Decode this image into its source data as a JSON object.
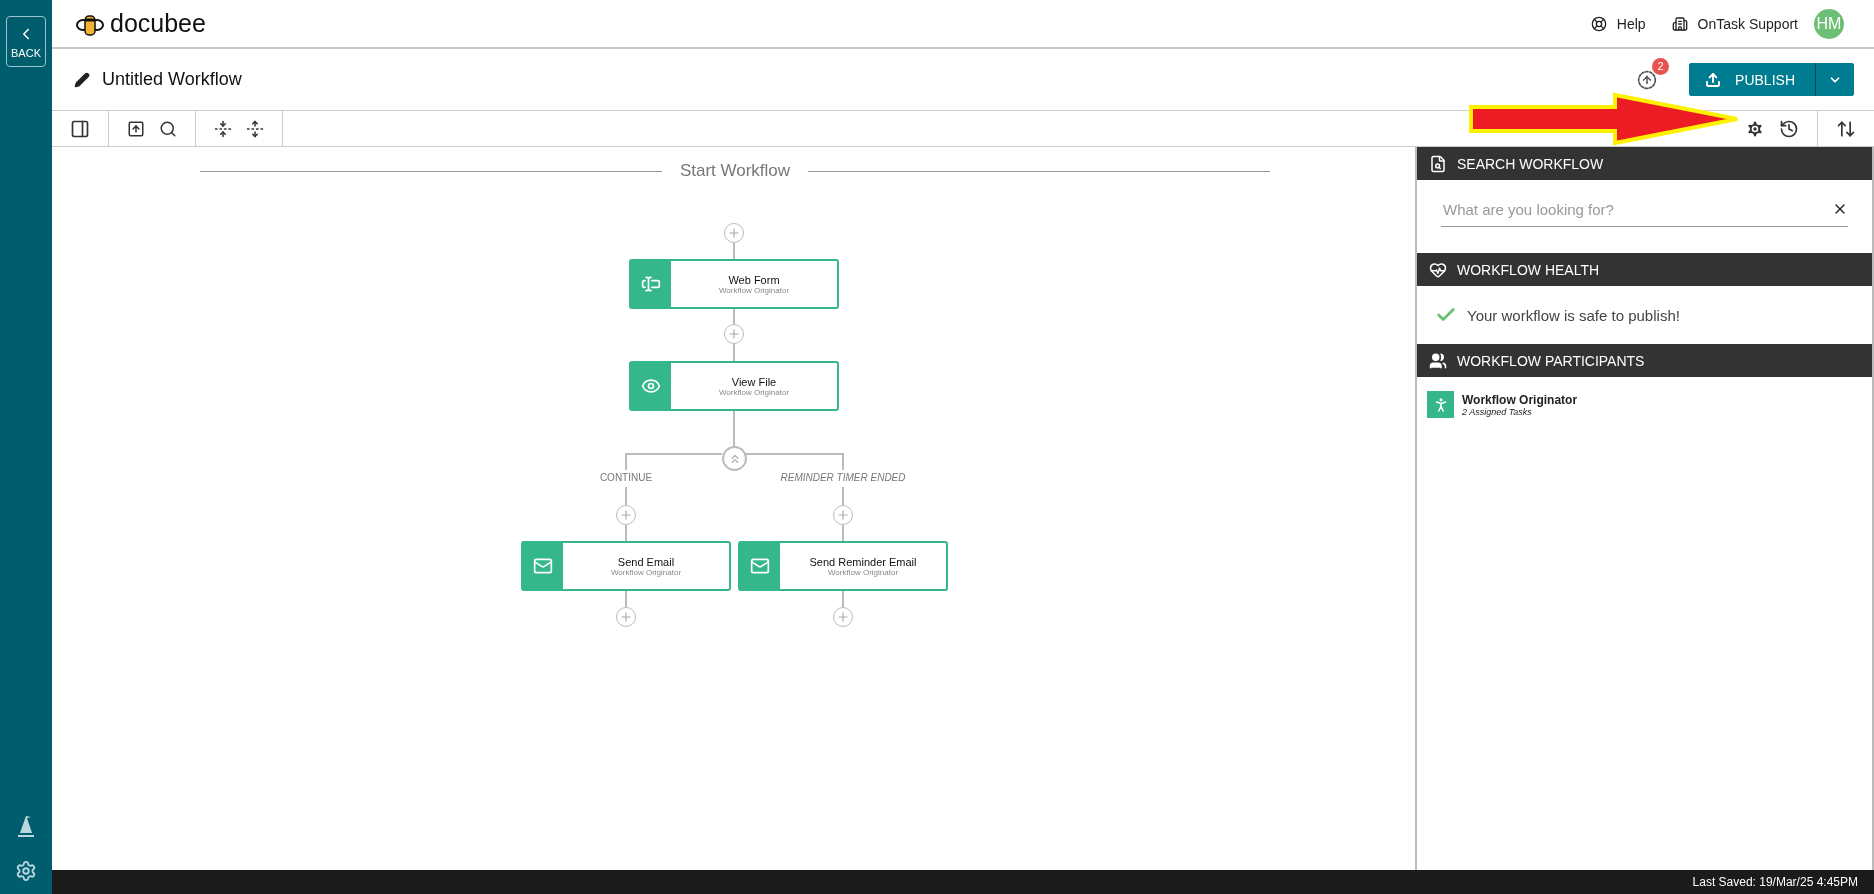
{
  "sidebar": {
    "back_label": "BACK"
  },
  "header": {
    "logo": "docubee",
    "links": [
      {
        "label": "Help",
        "kind": "help"
      },
      {
        "label": "OnTask Support",
        "kind": "support"
      }
    ],
    "avatar": "HM"
  },
  "title_bar": {
    "title": "Untitled Workflow",
    "notification_count": "2",
    "publish_label": "PUBLISH"
  },
  "canvas": {
    "heading": "Start Workflow",
    "nodes": [
      {
        "title": "Web Form",
        "subtitle": "Workflow Originator",
        "kind": "form"
      },
      {
        "title": "View File",
        "subtitle": "Workflow Originator",
        "kind": "view"
      },
      {
        "title": "Send Email",
        "subtitle": "Workflow Originator",
        "kind": "email"
      },
      {
        "title": "Send Reminder Email",
        "subtitle": "Workflow Originator",
        "kind": "email"
      }
    ],
    "branches": [
      {
        "label": "CONTINUE",
        "italic": false
      },
      {
        "label": "REMINDER TIMER ENDED",
        "italic": true
      }
    ]
  },
  "panel": {
    "search": {
      "title": "SEARCH WORKFLOW",
      "placeholder": "What are you looking for?"
    },
    "health": {
      "title": "WORKFLOW HEALTH",
      "message": "Your workflow is safe to publish!"
    },
    "participants": {
      "title": "WORKFLOW PARTICIPANTS",
      "items": [
        {
          "name": "Workflow Originator",
          "tasks": "2 Assigned Tasks"
        }
      ]
    }
  },
  "status_bar": {
    "last_saved": "Last Saved: 19/Mar/25 4:45PM"
  }
}
